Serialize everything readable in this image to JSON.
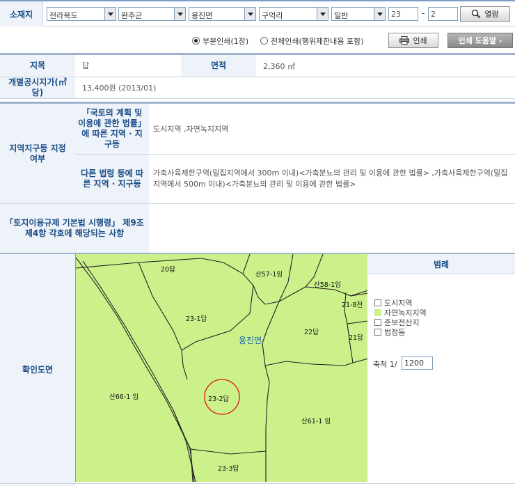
{
  "location": {
    "label": "소재지",
    "province": "전라북도",
    "county": "완주군",
    "town": "용진면",
    "village": "구억리",
    "land_type": "일반",
    "main_number": "23",
    "separator": "-",
    "sub_number": "2",
    "view_button": "열람"
  },
  "print": {
    "option_partial": "부분인쇄(1장)",
    "option_full": "전체인쇄(행위제한내용 포함)",
    "selected": "partial",
    "print_button": "인쇄",
    "help_button": "인쇄 도움말 ›"
  },
  "parcel": {
    "category_label": "지목",
    "category_value": "답",
    "area_label": "면적",
    "area_value": "2,360 ㎡",
    "price_label": "개별공시지가(㎡당)",
    "price_value": "13,400원 (2013/01)"
  },
  "zoning": {
    "section_label": "지역지구등 지정여부",
    "law1_label": "「국토의 계획 및 이용에 관한 법률」 에 따른 지역 · 지구등",
    "law1_value": "도시지역 ,자연녹지지역",
    "law2_label": "다른 법령 등에 따른 지역 · 지구등",
    "law2_value": "가축사육제한구역(밀집지역에서 300m 이내)<가축분뇨의 관리 및 이용에 관한 법률> ,가축사육제한구역(밀집지역에서 500m 이내)<가축분뇨의 관리 및 이용에 관한 법률>",
    "article_label": "「토지이용규제 기본법 시행령」 제9조제4항 각호에 해당되는 사항",
    "article_value": ""
  },
  "map": {
    "section_label": "확인도면",
    "region_label": "용진면",
    "parcels": [
      "20답",
      "산57-1임",
      "산58-1임",
      "21-8전",
      "23-1답",
      "22답",
      "21답",
      "산66-1 임",
      "23-2답",
      "산61-1 임",
      "23-3답"
    ],
    "fill_color": "#ccf08a",
    "highlight_color": "#dd1111"
  },
  "legend": {
    "title": "범례",
    "items": [
      "도시지역",
      "자연녹지지역",
      "준보전산지",
      "법정동"
    ],
    "item_colors": [
      "#ffffff",
      "#ccf08a",
      "#ffffff",
      "#ffffff"
    ],
    "scale_label": "축척 1/",
    "scale_value": "1200"
  }
}
